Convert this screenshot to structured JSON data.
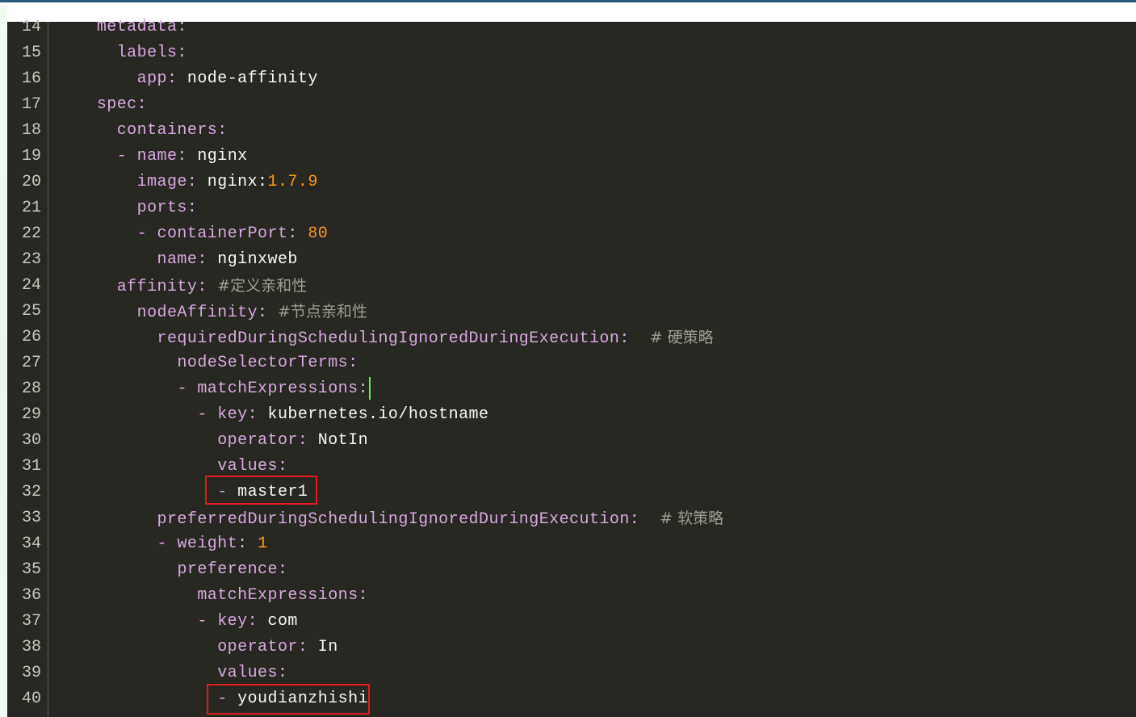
{
  "editor": {
    "language": "yaml",
    "theme_colors": {
      "background": "#272822",
      "key": "#d9a8e0",
      "value": "#f8f8f2",
      "number": "#fd971f",
      "comment": "#9e9e94",
      "cursor": "#5cf25c",
      "highlight_box": "#e11b22"
    },
    "lines": [
      {
        "no": "14",
        "indent": "    ",
        "key": "metadata:",
        "value": "",
        "num": "",
        "comment": ""
      },
      {
        "no": "15",
        "indent": "      ",
        "key": "labels:",
        "value": "",
        "num": "",
        "comment": ""
      },
      {
        "no": "16",
        "indent": "        ",
        "key": "app:",
        "value": " node-affinity",
        "num": "",
        "comment": ""
      },
      {
        "no": "17",
        "indent": "    ",
        "key": "spec:",
        "value": "",
        "num": "",
        "comment": ""
      },
      {
        "no": "18",
        "indent": "      ",
        "key": "containers:",
        "value": "",
        "num": "",
        "comment": ""
      },
      {
        "no": "19",
        "indent": "      ",
        "dash": "- ",
        "key": "name:",
        "value": " nginx",
        "num": "",
        "comment": ""
      },
      {
        "no": "20",
        "indent": "        ",
        "key": "image:",
        "value": " nginx:",
        "num": "1.7.9",
        "comment": ""
      },
      {
        "no": "21",
        "indent": "        ",
        "key": "ports:",
        "value": "",
        "num": "",
        "comment": ""
      },
      {
        "no": "22",
        "indent": "        ",
        "dash": "- ",
        "key": "containerPort:",
        "value": " ",
        "num": "80",
        "comment": ""
      },
      {
        "no": "23",
        "indent": "          ",
        "key": "name:",
        "value": " nginxweb",
        "num": "",
        "comment": ""
      },
      {
        "no": "24",
        "indent": "      ",
        "key": "affinity:",
        "value": " ",
        "num": "",
        "comment": "#定义亲和性"
      },
      {
        "no": "25",
        "indent": "        ",
        "key": "nodeAffinity:",
        "value": " ",
        "num": "",
        "comment": "#节点亲和性"
      },
      {
        "no": "26",
        "indent": "          ",
        "key": "requiredDuringSchedulingIgnoredDuringExecution:",
        "value": "  ",
        "num": "",
        "comment": "# 硬策略"
      },
      {
        "no": "27",
        "indent": "            ",
        "key": "nodeSelectorTerms:",
        "value": "",
        "num": "",
        "comment": ""
      },
      {
        "no": "28",
        "indent": "            ",
        "dash": "- ",
        "key": "matchExpressions:",
        "value": "",
        "num": "",
        "comment": "",
        "cursor": true
      },
      {
        "no": "29",
        "indent": "              ",
        "dash": "- ",
        "key": "key:",
        "value": " kubernetes.io/hostname",
        "num": "",
        "comment": ""
      },
      {
        "no": "30",
        "indent": "                ",
        "key": "operator:",
        "value": " NotIn",
        "num": "",
        "comment": ""
      },
      {
        "no": "31",
        "indent": "                ",
        "key": "values:",
        "value": "",
        "num": "",
        "comment": ""
      },
      {
        "no": "32",
        "indent": "                ",
        "dash": "- ",
        "key": "",
        "value": "master1",
        "num": "",
        "comment": ""
      },
      {
        "no": "33",
        "indent": "          ",
        "key": "preferredDuringSchedulingIgnoredDuringExecution:",
        "value": "  ",
        "num": "",
        "comment": "# 软策略"
      },
      {
        "no": "34",
        "indent": "          ",
        "dash": "- ",
        "key": "weight:",
        "value": " ",
        "num": "1",
        "comment": ""
      },
      {
        "no": "35",
        "indent": "            ",
        "key": "preference:",
        "value": "",
        "num": "",
        "comment": ""
      },
      {
        "no": "36",
        "indent": "              ",
        "key": "matchExpressions:",
        "value": "",
        "num": "",
        "comment": ""
      },
      {
        "no": "37",
        "indent": "              ",
        "dash": "- ",
        "key": "key:",
        "value": " com",
        "num": "",
        "comment": ""
      },
      {
        "no": "38",
        "indent": "                ",
        "key": "operator:",
        "value": " In",
        "num": "",
        "comment": ""
      },
      {
        "no": "39",
        "indent": "                ",
        "key": "values:",
        "value": "",
        "num": "",
        "comment": ""
      },
      {
        "no": "40",
        "indent": "                ",
        "dash": "- ",
        "key": "",
        "value": "youdianzhishi",
        "num": "",
        "comment": ""
      }
    ]
  }
}
